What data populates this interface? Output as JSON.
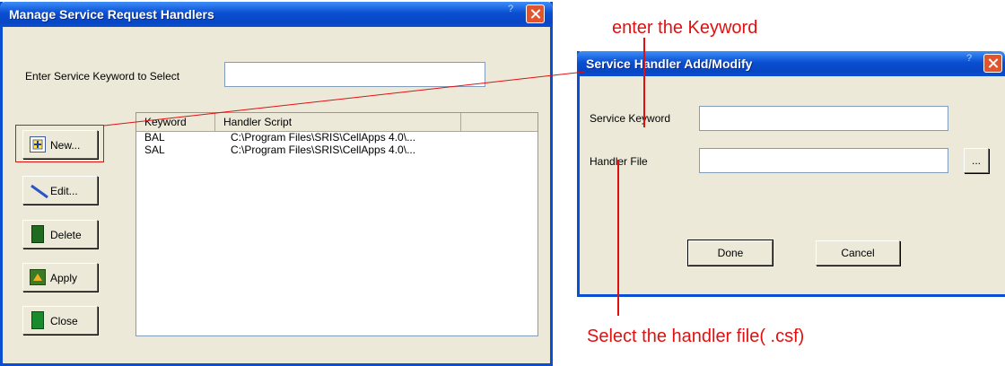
{
  "main_window": {
    "title": "Manage Service Request Handlers",
    "keyword_label": "Enter Service Keyword to Select",
    "keyword_value": "",
    "buttons": [
      "New...",
      "Edit...",
      "Delete",
      "Apply",
      "Close"
    ],
    "list": {
      "columns": [
        "Keyword",
        "Handler Script"
      ],
      "rows": [
        {
          "keyword": "BAL",
          "script": "C:\\Program Files\\SRIS\\CellApps 4.0\\..."
        },
        {
          "keyword": "SAL",
          "script": "C:\\Program Files\\SRIS\\CellApps 4.0\\..."
        }
      ]
    }
  },
  "dialog": {
    "title": "Service Handler Add/Modify",
    "keyword_label": "Service Keyword",
    "keyword_value": "",
    "file_label": "Handler File",
    "file_value": "",
    "browse_label": "...",
    "done_label": "Done",
    "cancel_label": "Cancel"
  },
  "annotations": {
    "top": "enter the Keyword",
    "bottom": "Select the handler file( .csf)"
  },
  "colors": {
    "titlebar": "#0a4fd1",
    "annotation": "#e01010"
  }
}
